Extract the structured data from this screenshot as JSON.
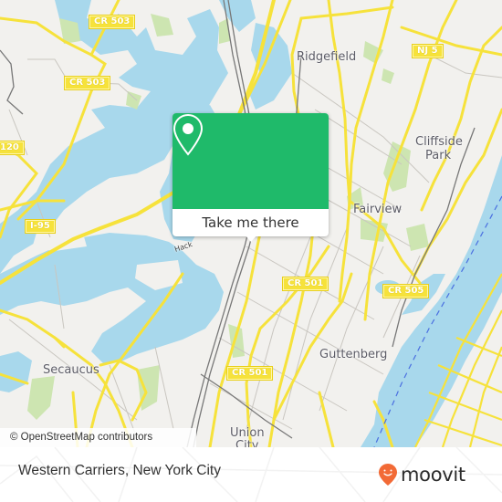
{
  "map": {
    "colors": {
      "land": "#f2f1ee",
      "water": "#a8d8ec",
      "park": "#cde5b1",
      "road_major": "#f6e23b",
      "road_minor": "#c9c6c0",
      "rail": "#777777",
      "boundary_dash": "#4a6fe0"
    },
    "road_shields": [
      {
        "label": "CR 503",
        "id": "cr503-north"
      },
      {
        "label": "CR 503",
        "id": "cr503-west"
      },
      {
        "label": "120",
        "id": "route-120"
      },
      {
        "label": "I-95",
        "id": "i95"
      },
      {
        "label": "NJ 5",
        "id": "nj5"
      },
      {
        "label": "CR 501",
        "id": "cr501-north"
      },
      {
        "label": "CR 505",
        "id": "cr505"
      },
      {
        "label": "CR 501",
        "id": "cr501-south"
      }
    ],
    "place_labels": [
      {
        "label": "Ridgefield"
      },
      {
        "label": "Cliffside"
      },
      {
        "label": "Park"
      },
      {
        "label": "Fairview"
      },
      {
        "label": "Guttenberg"
      },
      {
        "label": "Secaucus"
      },
      {
        "label": "Union"
      },
      {
        "label": "City"
      },
      {
        "label": "Hack"
      }
    ],
    "attribution": "© OpenStreetMap contributors"
  },
  "popup": {
    "icon": "location-pin-icon",
    "button_label": "Take me there",
    "accent_color": "#1fba6a"
  },
  "footer": {
    "title": "Western Carriers, New York City",
    "logo_text": "moovit",
    "logo_icon": "moovit-smiley-pin-icon",
    "logo_color": "#f26a36"
  }
}
